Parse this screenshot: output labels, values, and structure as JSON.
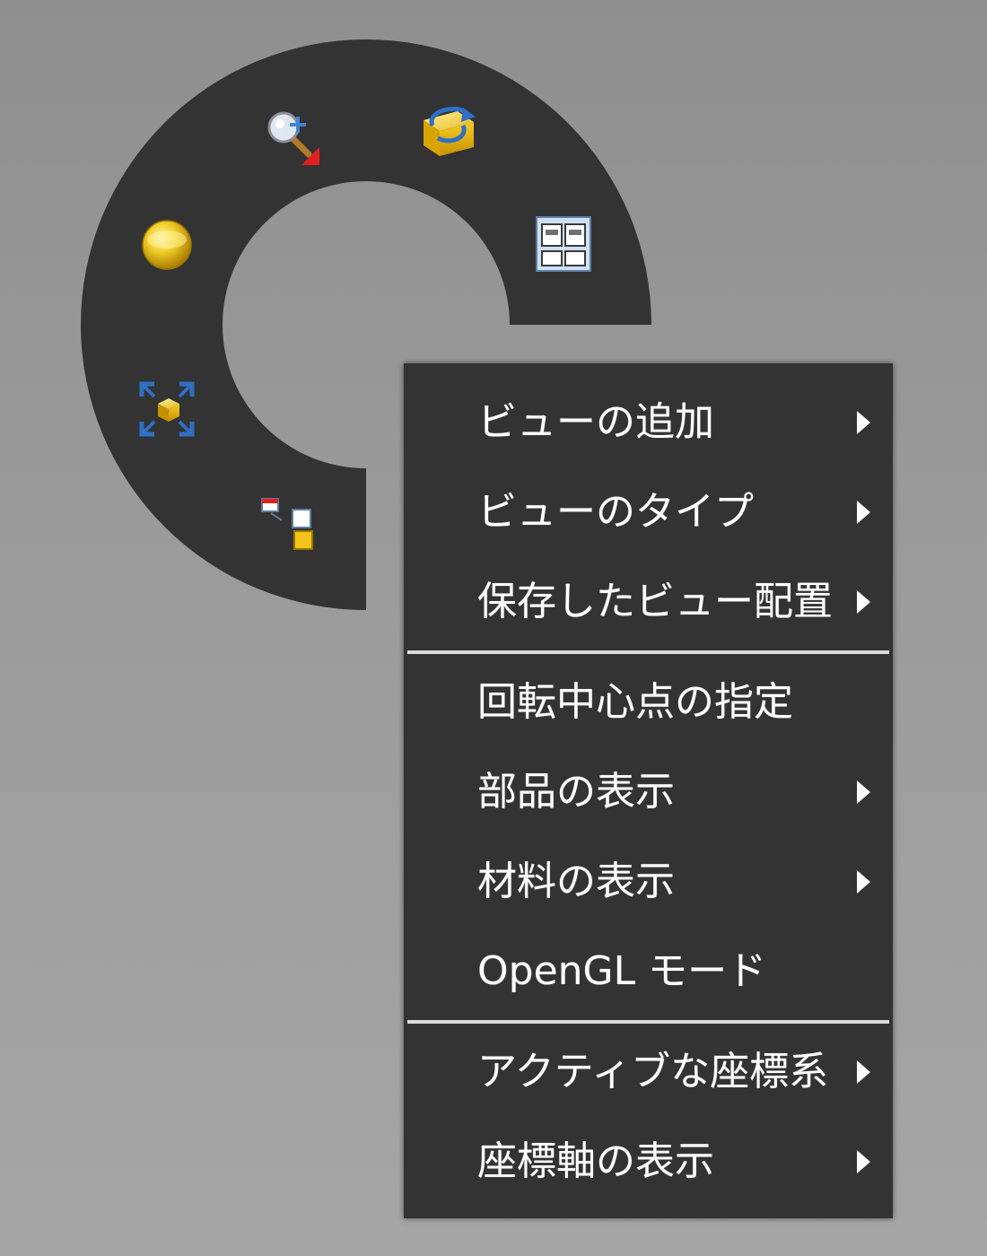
{
  "radial_menu": {
    "buttons": [
      {
        "name": "zoom-window-icon"
      },
      {
        "name": "view-orientation-icon"
      },
      {
        "name": "shaded-sphere-icon"
      },
      {
        "name": "view-layout-icon"
      },
      {
        "name": "zoom-fit-icon"
      },
      {
        "name": "view-restore-icon"
      }
    ]
  },
  "context_menu": {
    "groups": [
      [
        {
          "label": "ビューの追加",
          "submenu": true
        },
        {
          "label": "ビューのタイプ",
          "submenu": true
        },
        {
          "label": "保存したビュー配置",
          "submenu": true
        }
      ],
      [
        {
          "label": "回転中心点の指定",
          "submenu": false
        },
        {
          "label": "部品の表示",
          "submenu": true
        },
        {
          "label": "材料の表示",
          "submenu": true
        },
        {
          "label": "OpenGL モード",
          "submenu": false
        }
      ],
      [
        {
          "label": "アクティブな座標系",
          "submenu": true
        },
        {
          "label": "座標軸の表示",
          "submenu": true
        }
      ]
    ]
  },
  "colors": {
    "menu_background": "#333333",
    "menu_text": "#ffffff",
    "separator": "#dcdcdc",
    "background": "#999999"
  }
}
